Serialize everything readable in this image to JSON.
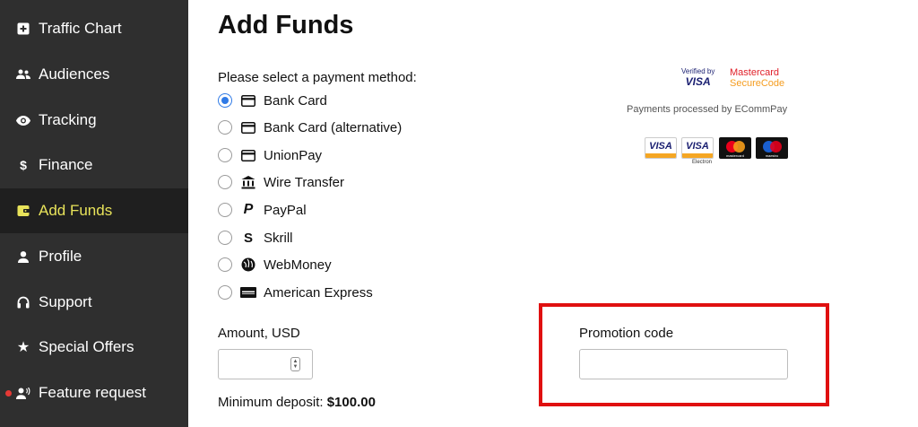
{
  "sidebar": {
    "items": [
      {
        "label": "Traffic Chart",
        "icon": "add-box-icon",
        "active": false
      },
      {
        "label": "Audiences",
        "icon": "people-icon",
        "active": false
      },
      {
        "label": "Tracking",
        "icon": "eye-icon",
        "active": false
      },
      {
        "label": "Finance",
        "icon": "dollar-icon",
        "active": false
      },
      {
        "label": "Add Funds",
        "icon": "wallet-icon",
        "active": true
      },
      {
        "label": "Profile",
        "icon": "person-icon",
        "active": false
      },
      {
        "label": "Support",
        "icon": "headset-icon",
        "active": false
      },
      {
        "label": "Special Offers",
        "icon": "star-icon",
        "active": false
      },
      {
        "label": "Feature request",
        "icon": "person-voice-icon",
        "active": false,
        "notification_dot": true
      }
    ],
    "accent_color": "#e8e35a",
    "background_color": "#2f2f2f"
  },
  "main": {
    "title": "Add Funds",
    "payment_prompt": "Please select a payment method:",
    "selected_method": "Bank Card",
    "methods": [
      {
        "label": "Bank Card",
        "icon": "credit-card-icon",
        "checked": true
      },
      {
        "label": "Bank Card (alternative)",
        "icon": "credit-card-icon",
        "checked": false
      },
      {
        "label": "UnionPay",
        "icon": "credit-card-icon",
        "checked": false
      },
      {
        "label": "Wire Transfer",
        "icon": "bank-icon",
        "checked": false
      },
      {
        "label": "PayPal",
        "icon": "paypal-icon",
        "checked": false
      },
      {
        "label": "Skrill",
        "icon": "skrill-icon",
        "checked": false
      },
      {
        "label": "WebMoney",
        "icon": "webmoney-icon",
        "checked": false
      },
      {
        "label": "American Express",
        "icon": "amex-icon",
        "checked": false
      }
    ],
    "amount": {
      "label": "Amount, USD",
      "value": "",
      "min_deposit_label": "Minimum deposit:",
      "min_deposit_value": "$100.00"
    },
    "promo": {
      "label": "Promotion code",
      "value": "",
      "highlight_color": "#e01010"
    }
  },
  "badges": {
    "verified_by": "Verified by",
    "verified_visa": "VISA",
    "mastercard": "Mastercard",
    "securecode": "SecureCode",
    "processed_text": "Payments processed by ECommPay",
    "card_logos": [
      {
        "name": "VISA",
        "sub": ""
      },
      {
        "name": "VISA",
        "sub": "Electron"
      },
      {
        "name": "mastercard",
        "sub": ""
      },
      {
        "name": "maestro",
        "sub": ""
      }
    ]
  },
  "colors": {
    "radio_selected": "#2f7ae6"
  }
}
